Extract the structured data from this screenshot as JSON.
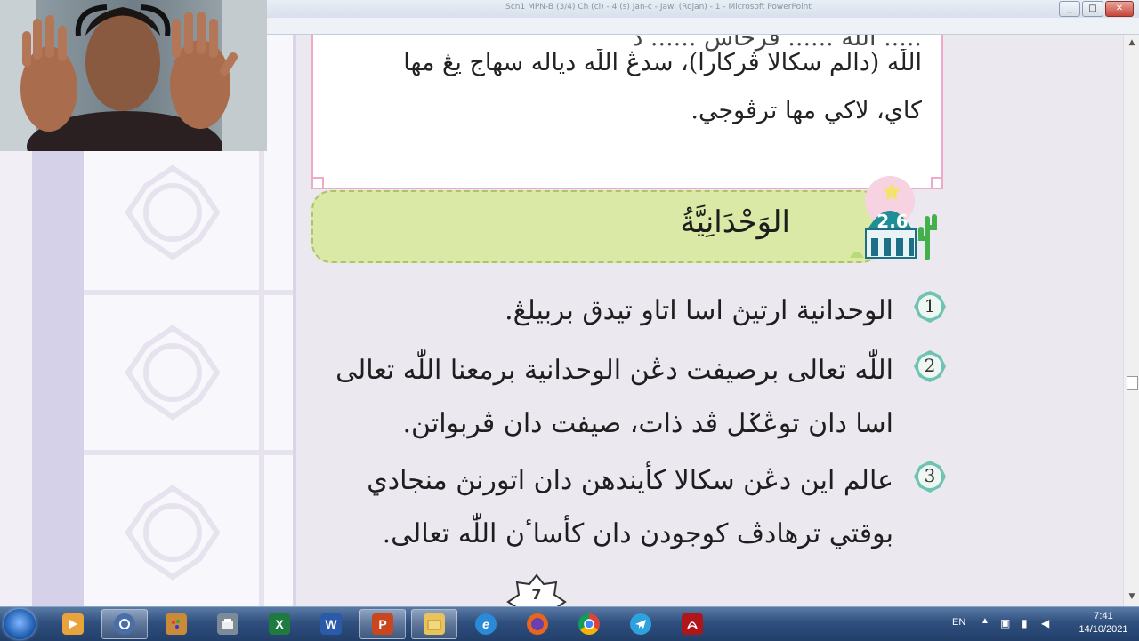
{
  "window": {
    "title": "Scn1 MPN-B (3/4) Ch (ci) - 4 (s) Jan-c - Jawi (Rojan) - 1 - Microsoft PowerPoint",
    "buttons": [
      "_",
      "□",
      "✕"
    ]
  },
  "slide": {
    "box_lines": [
      "..... الله ...... فرخاس ...... د",
      "اللّٰه (دالم سکالا ڤرکارا)، سدڠ اللّٰه دياله سهاج يڠ مها",
      "کاي، لاکي مها ترڤوجي."
    ],
    "section": {
      "badge": "2.6",
      "title": "الوَحْدَانِيَّةُ"
    },
    "points": [
      {
        "number": "1",
        "lines": [
          "الوحدانية ارتيڽ اسا اتاو تيدق بربيلڠ."
        ]
      },
      {
        "number": "2",
        "lines": [
          "اللّٰه تعالى برصيفت دڠن الوحدانية برمعنا اللّٰه تعالى",
          "اسا دان توڠݢل ڤد ذات، صيفت دان ڤربواتن."
        ]
      },
      {
        "number": "3",
        "lines": [
          "عالم اين دڠن سکالا کأيندهن دان اتورنڽ منجادي",
          "بوقتي ترهادڤ کوجودن دان کأساٴن اللّٰه تعالى."
        ]
      }
    ],
    "star_number": "7"
  },
  "taskbar": {
    "apps": [
      {
        "name": "media-player",
        "label": "",
        "color": "#e8a33a"
      },
      {
        "name": "media-center",
        "label": "",
        "color": "#4a6fa8"
      },
      {
        "name": "paint",
        "label": "",
        "color": "#c98a3a"
      },
      {
        "name": "fax",
        "label": "",
        "color": "#7d8b99"
      },
      {
        "name": "excel",
        "label": "X",
        "color": "#1f7a3f"
      },
      {
        "name": "word",
        "label": "W",
        "color": "#2a5aa8"
      },
      {
        "name": "powerpoint",
        "label": "P",
        "color": "#c9461e"
      },
      {
        "name": "explorer",
        "label": "",
        "color": "#e7c35a"
      },
      {
        "name": "internet-explorer",
        "label": "e",
        "color": "#2a8ad8"
      },
      {
        "name": "firefox",
        "label": "",
        "color": "#e8651c"
      },
      {
        "name": "chrome",
        "label": "",
        "color": "#3aa957"
      },
      {
        "name": "telegram",
        "label": "",
        "color": "#2ea2dc"
      },
      {
        "name": "acrobat",
        "label": "",
        "color": "#b0151a"
      }
    ],
    "tray": {
      "language": "EN",
      "time": "7:41",
      "date": "14/10/2021"
    }
  }
}
